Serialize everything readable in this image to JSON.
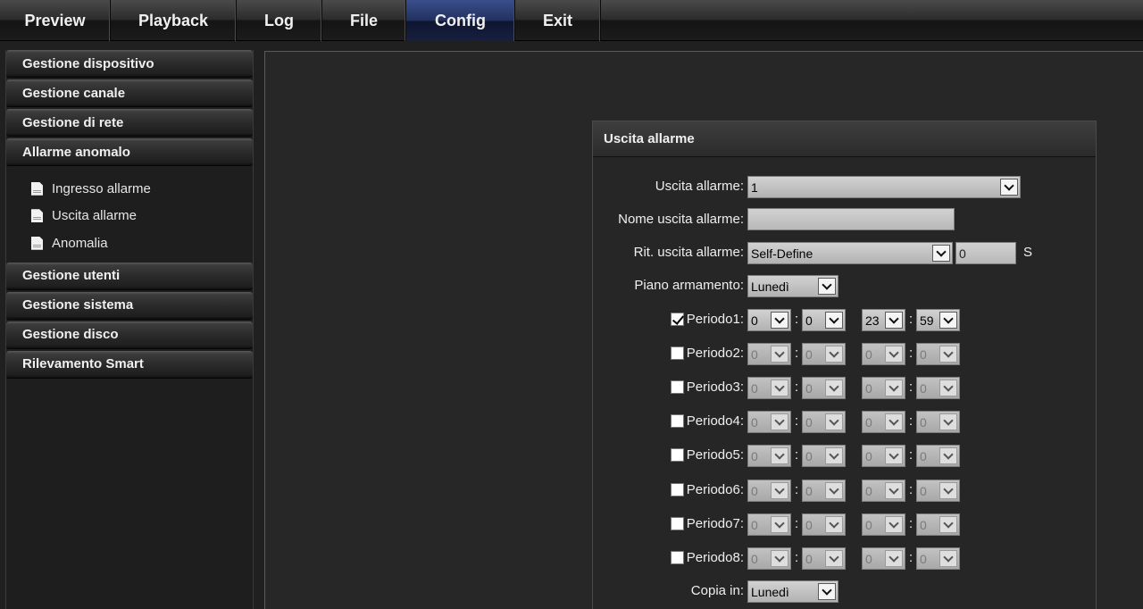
{
  "topnav": {
    "tabs": [
      {
        "label": "Preview",
        "name": "tab-preview"
      },
      {
        "label": "Playback",
        "name": "tab-playback"
      },
      {
        "label": "Log",
        "name": "tab-log"
      },
      {
        "label": "File",
        "name": "tab-file"
      },
      {
        "label": "Config",
        "name": "tab-config"
      },
      {
        "label": "Exit",
        "name": "tab-exit"
      }
    ],
    "active": "Config"
  },
  "sidebar": {
    "items_top": [
      {
        "label": "Gestione dispositivo"
      },
      {
        "label": "Gestione canale"
      },
      {
        "label": "Gestione di rete"
      },
      {
        "label": "Allarme anomalo"
      }
    ],
    "sub_items": [
      {
        "label": "Ingresso allarme"
      },
      {
        "label": "Uscita allarme"
      },
      {
        "label": "Anomalia"
      }
    ],
    "items_bottom": [
      {
        "label": "Gestione utenti"
      },
      {
        "label": "Gestione sistema"
      },
      {
        "label": "Gestione disco"
      },
      {
        "label": "Rilevamento Smart"
      }
    ]
  },
  "panel": {
    "title": "Uscita allarme",
    "alarm_output": {
      "label": "Uscita allarme:",
      "value": "1"
    },
    "output_name": {
      "label": "Nome uscita allarme:",
      "value": ""
    },
    "delay": {
      "label": "Rit. uscita allarme:",
      "mode": "Self-Define",
      "value": "0",
      "unit": "S"
    },
    "schedule": {
      "label": "Piano armamento:",
      "value": "Lunedì"
    },
    "periods": [
      {
        "label": "Periodo1:",
        "checked": true,
        "start_h": "0",
        "start_m": "0",
        "end_h": "23",
        "end_m": "59"
      },
      {
        "label": "Periodo2:",
        "checked": false,
        "start_h": "0",
        "start_m": "0",
        "end_h": "0",
        "end_m": "0"
      },
      {
        "label": "Periodo3:",
        "checked": false,
        "start_h": "0",
        "start_m": "0",
        "end_h": "0",
        "end_m": "0"
      },
      {
        "label": "Periodo4:",
        "checked": false,
        "start_h": "0",
        "start_m": "0",
        "end_h": "0",
        "end_m": "0"
      },
      {
        "label": "Periodo5:",
        "checked": false,
        "start_h": "0",
        "start_m": "0",
        "end_h": "0",
        "end_m": "0"
      },
      {
        "label": "Periodo6:",
        "checked": false,
        "start_h": "0",
        "start_m": "0",
        "end_h": "0",
        "end_m": "0"
      },
      {
        "label": "Periodo7:",
        "checked": false,
        "start_h": "0",
        "start_m": "0",
        "end_h": "0",
        "end_m": "0"
      },
      {
        "label": "Periodo8:",
        "checked": false,
        "start_h": "0",
        "start_m": "0",
        "end_h": "0",
        "end_m": "0"
      }
    ],
    "copy_to": {
      "label": "Copia in:",
      "value": "Lunedì"
    }
  }
}
